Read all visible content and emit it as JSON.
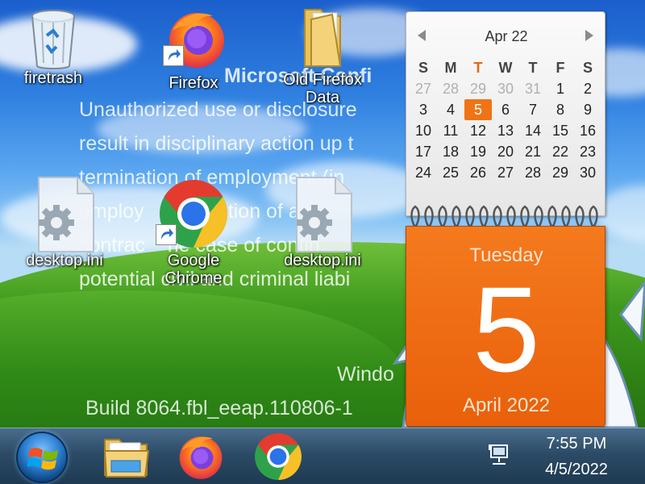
{
  "watermark": {
    "title": "Microsoft Confi",
    "lines": [
      "Unauthorized use or disclosure",
      "result in disciplinary action up t",
      "termination of employment (in",
      "employ    ermination of an",
      "contrac    he case of contin",
      "potential civil and criminal liabi"
    ],
    "build_line_1": "Windo",
    "build_line_2": "Build 8064.fbl_eeap.110806-1"
  },
  "desktop": {
    "icons": [
      {
        "label": "firetrash",
        "icon": "recycle-bin-icon"
      },
      {
        "label": "Firefox",
        "icon": "firefox-icon"
      },
      {
        "label": "Old Firefox Data",
        "icon": "folder-icon"
      },
      {
        "label": "desktop.ini",
        "icon": "settings-file-icon"
      },
      {
        "label": "Google Chrome",
        "icon": "chrome-icon"
      },
      {
        "label": "desktop.ini",
        "icon": "settings-file-icon"
      }
    ]
  },
  "calendar": {
    "month_label": "Apr 22",
    "weekdays": [
      "S",
      "M",
      "T",
      "W",
      "T",
      "F",
      "S"
    ],
    "rows": [
      [
        "27",
        "28",
        "29",
        "30",
        "31",
        "1",
        "2"
      ],
      [
        "3",
        "4",
        "5",
        "6",
        "7",
        "8",
        "9"
      ],
      [
        "10",
        "11",
        "12",
        "13",
        "14",
        "15",
        "16"
      ],
      [
        "17",
        "18",
        "19",
        "20",
        "21",
        "22",
        "23"
      ],
      [
        "24",
        "25",
        "26",
        "27",
        "28",
        "29",
        "30"
      ]
    ],
    "today": "5",
    "day_of_week": "Tuesday",
    "day_number": "5",
    "month_year": "April 2022",
    "accent_color": "#f07316"
  },
  "taskbar": {
    "start_button": "windows-orb-icon",
    "pinned": [
      {
        "name": "File Explorer",
        "icon": "file-explorer-icon"
      },
      {
        "name": "Firefox",
        "icon": "firefox-icon"
      },
      {
        "name": "Google Chrome",
        "icon": "chrome-icon"
      }
    ],
    "tray_icon": "network-icon",
    "time": "7:55 PM",
    "date": "4/5/2022"
  }
}
